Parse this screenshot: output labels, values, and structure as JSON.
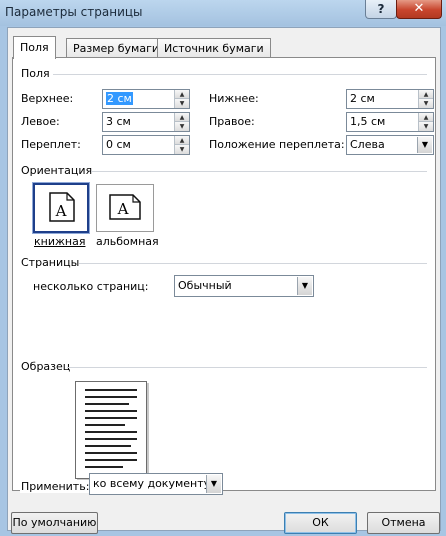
{
  "window": {
    "title": "Параметры страницы",
    "help_label": "?",
    "close_label": "✕"
  },
  "tabs": [
    {
      "label": "Поля",
      "active": true
    },
    {
      "label": "Размер бумаги",
      "active": false
    },
    {
      "label": "Источник бумаги",
      "active": false
    }
  ],
  "margins": {
    "section_label": "Поля",
    "top": {
      "label": "Верхнее:",
      "value": "2 см"
    },
    "bottom": {
      "label": "Нижнее:",
      "value": "2 см"
    },
    "left": {
      "label": "Левое:",
      "value": "3 см"
    },
    "right": {
      "label": "Правое:",
      "value": "1,5 см"
    },
    "gutter": {
      "label": "Переплет:",
      "value": "0 см"
    },
    "gutter_pos": {
      "label": "Положение переплета:",
      "value": "Слева"
    }
  },
  "orientation": {
    "section_label": "Ориентация",
    "glyph": "A",
    "portrait_label": "книжная",
    "landscape_label": "альбомная",
    "selected": "portrait"
  },
  "pages": {
    "section_label": "Страницы",
    "multiple_label": "несколько страниц:",
    "multiple_value": "Обычный"
  },
  "preview": {
    "section_label": "Образец"
  },
  "apply": {
    "label": "Применить:",
    "value": "ко всему документу"
  },
  "buttons": {
    "default_label": "По умолчанию",
    "ok_label": "ОК",
    "cancel_label": "Отмена"
  },
  "icons": {
    "spin_up": "▲",
    "spin_down": "▼",
    "dropdown": "▼"
  },
  "colors": {
    "title_bar": "#a7c5e3",
    "close": "#c8452d",
    "selection": "#3399ff",
    "selected_border": "#1e3f8a"
  }
}
